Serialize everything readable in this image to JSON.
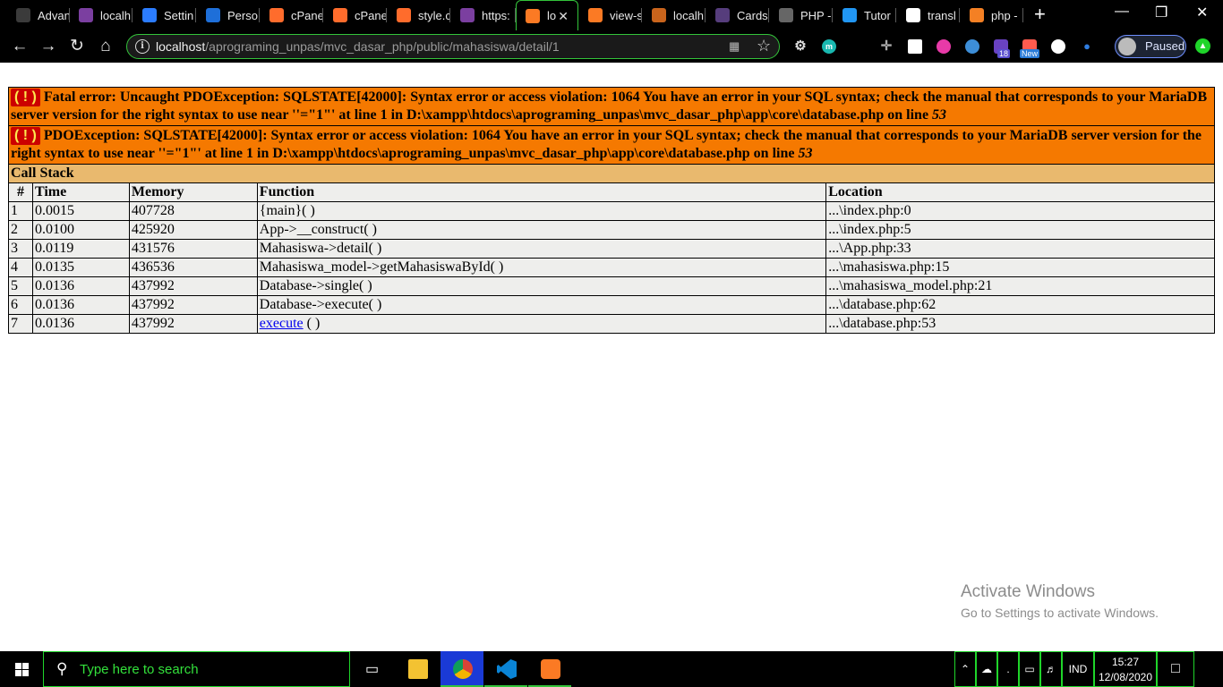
{
  "browser": {
    "tabs": [
      {
        "label": "Advan",
        "icon": "adventure-icon",
        "color": "#3b3b3b"
      },
      {
        "label": "localh",
        "icon": "rocket-icon",
        "color": "#7b3fa0"
      },
      {
        "label": "Settin",
        "icon": "gear-icon",
        "color": "#2b7cff"
      },
      {
        "label": "Perso",
        "icon": "chart-icon",
        "color": "#1e6fd9"
      },
      {
        "label": "cPane",
        "icon": "cpanel-icon",
        "color": "#ff6c2c"
      },
      {
        "label": "cPane",
        "icon": "cpanel-icon",
        "color": "#ff6c2c"
      },
      {
        "label": "style.c",
        "icon": "cpanel-icon",
        "color": "#ff6c2c"
      },
      {
        "label": "https:",
        "icon": "rocket-icon",
        "color": "#7b3fa0"
      },
      {
        "label": "lo",
        "icon": "xampp-icon",
        "color": "#fb7a24",
        "active": true
      },
      {
        "label": "view-s",
        "icon": "xampp-icon",
        "color": "#fb7a24"
      },
      {
        "label": "localh",
        "icon": "mountain-icon",
        "color": "#c9641c"
      },
      {
        "label": "Cards",
        "icon": "bootstrap-icon",
        "color": "#563d7c"
      },
      {
        "label": "PHP -",
        "icon": "globe-icon",
        "color": "#666666"
      },
      {
        "label": "Tutor",
        "icon": "w3-icon",
        "color": "#2196f3"
      },
      {
        "label": "transl",
        "icon": "google-icon",
        "color": "#ffffff"
      },
      {
        "label": "php -",
        "icon": "stackoverflow-icon",
        "color": "#f48024"
      }
    ],
    "url_host": "localhost",
    "url_path": "/aprograming_unpas/mvc_dasar_php/public/mahasiswa/detail/1",
    "profile_label": "Paused",
    "ext_badge_18": "18",
    "ext_badge_new": "New",
    "accent": "#33c43a"
  },
  "error": {
    "bang": "( ! )",
    "fatal_prefix": "Fatal error: Uncaught PDOException: SQLSTATE[42000]: Syntax error or access violation: 1064 You have an error in your SQL syntax; check the manual that corresponds to your MariaDB server version for the right syntax to use near ''=\"1\"' at line 1 in D:\\xampp\\htdocs\\aprograming_unpas\\mvc_dasar_php\\app\\core\\database.php on line ",
    "fatal_line": "53",
    "pdo_prefix": "PDOException: SQLSTATE[42000]: Syntax error or access violation: 1064 You have an error in your SQL syntax; check the manual that corresponds to your MariaDB server version for the right syntax to use near ''=\"1\"' at line 1 in D:\\xampp\\htdocs\\aprograming_unpas\\mvc_dasar_php\\app\\core\\database.php on line ",
    "pdo_line": "53",
    "callstack_title": "Call Stack",
    "headers": {
      "num": "#",
      "time": "Time",
      "memory": "Memory",
      "function": "Function",
      "location": "Location"
    },
    "rows": [
      {
        "num": "1",
        "time": "0.0015",
        "memory": "407728",
        "function": "{main}( )",
        "location": "...\\index.php:0"
      },
      {
        "num": "2",
        "time": "0.0100",
        "memory": "425920",
        "function": "App->__construct( )",
        "location": "...\\index.php:5"
      },
      {
        "num": "3",
        "time": "0.0119",
        "memory": "431576",
        "function": "Mahasiswa->detail( )",
        "location": "...\\App.php:33"
      },
      {
        "num": "4",
        "time": "0.0135",
        "memory": "436536",
        "function": "Mahasiswa_model->getMahasiswaById( )",
        "location": "...\\mahasiswa.php:15"
      },
      {
        "num": "5",
        "time": "0.0136",
        "memory": "437992",
        "function": "Database->single( )",
        "location": "...\\mahasiswa_model.php:21"
      },
      {
        "num": "6",
        "time": "0.0136",
        "memory": "437992",
        "function": "Database->execute( )",
        "location": "...\\database.php:62"
      },
      {
        "num": "7",
        "time": "0.0136",
        "memory": "437992",
        "function_link": "execute",
        "function_suffix": " ( )",
        "location": "...\\database.php:53"
      }
    ],
    "colors": {
      "error_bg": "#f57900",
      "callstack_bg": "#e9b96e",
      "row_bg": "#eeeeec",
      "bang_bg": "#cc0000",
      "bang_fg": "#fce94f"
    }
  },
  "watermark": {
    "title": "Activate Windows",
    "subtitle": "Go to Settings to activate Windows."
  },
  "taskbar": {
    "search_placeholder": "Type here to search",
    "apps": [
      "file-explorer-icon",
      "chrome-icon",
      "vscode-icon",
      "xampp-icon"
    ],
    "language": "IND",
    "time": "15:27",
    "date": "12/08/2020",
    "accent": "#1fd52a"
  }
}
